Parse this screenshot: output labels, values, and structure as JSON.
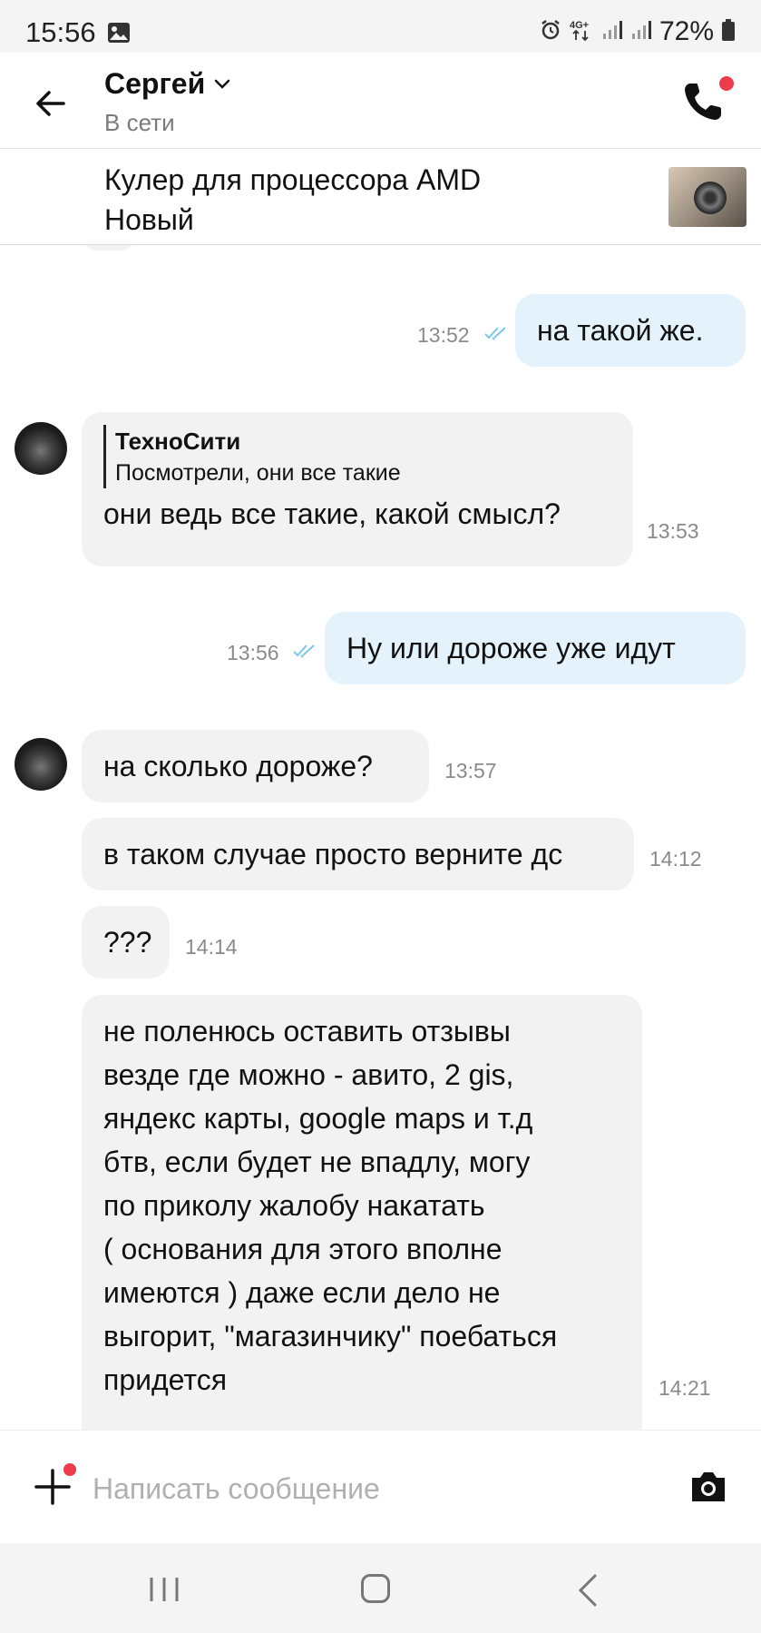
{
  "status_bar": {
    "time": "15:56",
    "battery": "72%",
    "network": "4G+",
    "icons": [
      "gallery-icon",
      "alarm-icon",
      "network-4g-icon",
      "signal-icon",
      "signal-icon",
      "battery-icon"
    ]
  },
  "header": {
    "contact_name": "Сергей",
    "contact_status": "В сети",
    "back_icon": "arrow-left-icon",
    "call_icon": "phone-icon",
    "notification_color": "#ec3b4b"
  },
  "ad": {
    "title_line1": "Кулер для процессора AMD",
    "title_line2": "Новый"
  },
  "messages": [
    {
      "direction": "out",
      "text": "на такой же.",
      "time": "13:52",
      "read": true
    },
    {
      "direction": "in",
      "quote_author": "ТехноСити",
      "quote_text": "Посмотрели, они все такие",
      "text": "они ведь все такие, какой смысл?",
      "time": "13:53"
    },
    {
      "direction": "out",
      "text": "Ну или дороже уже идут",
      "time": "13:56",
      "read": true
    },
    {
      "direction": "in",
      "text": "на сколько дороже?",
      "time": "13:57"
    },
    {
      "direction": "in",
      "text": "в таком случае просто верните дс",
      "time": "14:12"
    },
    {
      "direction": "in",
      "text": "???",
      "time": "14:14"
    },
    {
      "direction": "in",
      "lines": [
        "не поленюсь оставить отзывы",
        "везде где можно - авито, 2 gis,",
        "яндекс карты, google maps и т.д",
        "бтв, если будет не впадлу, могу",
        "по приколу жалобу накатать",
        "( основания для этого вполне",
        "имеются ) даже если дело не",
        "выгорит, \"магазинчику\" поебаться",
        "придется"
      ],
      "time": "14:21"
    }
  ],
  "composer": {
    "placeholder": "Написать сообщение",
    "value": ""
  },
  "colors": {
    "outgoing_bubble": "#e4f3fb",
    "incoming_bubble": "#f2f2f2",
    "read_ticks": "#7cc6ea"
  }
}
